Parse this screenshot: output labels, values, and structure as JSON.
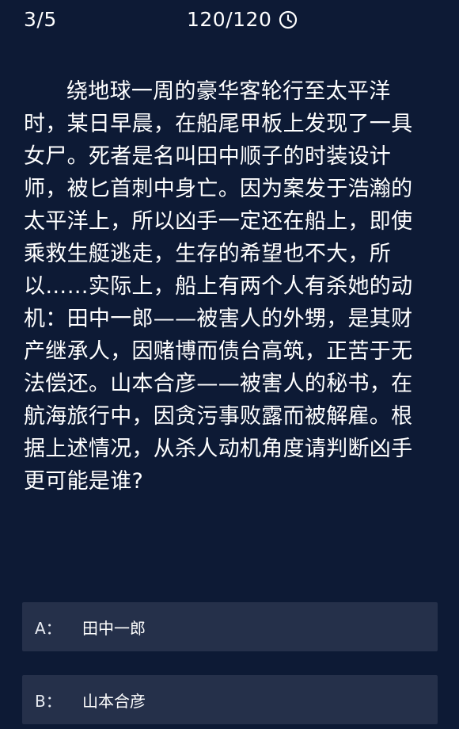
{
  "header": {
    "progress": "3/5",
    "timer": "120/120",
    "timer_icon": "clock-icon"
  },
  "question": {
    "text": "绕地球一周的豪华客轮行至太平洋时，某日早晨，在船尾甲板上发现了一具女尸。死者是名叫田中顺子的时装设计师，被匕首刺中身亡。因为案发于浩瀚的太平洋上，所以凶手一定还在船上，即使乘救生艇逃走，生存的希望也不大，所以……实际上，船上有两个人有杀她的动机：田中一郎——被害人的外甥，是其财产继承人，因赌博而债台高筑，正苦于无法偿还。山本合彦——被害人的秘书，在航海旅行中，因贪污事败露而被解雇。根据上述情况，从杀人动机角度请判断凶手更可能是谁?"
  },
  "options": [
    {
      "letter": "A：",
      "text": "田中一郎"
    },
    {
      "letter": "B：",
      "text": "山本合彦"
    }
  ],
  "colors": {
    "background": "#0d1a35",
    "option_background": "#25304a",
    "text": "#ffffff"
  }
}
